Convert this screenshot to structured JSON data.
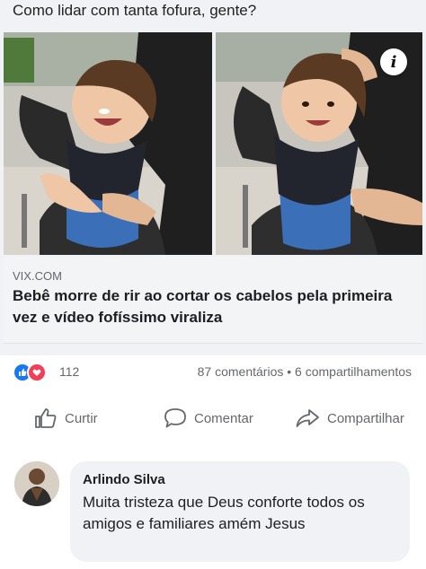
{
  "post": {
    "caption": "Como lidar com tanta fofura, gente?"
  },
  "link_preview": {
    "domain": "VIX.COM",
    "title": "Bebê morre de rir ao cortar os cabelos pela primeira vez e vídeo fofíssimo viraliza",
    "info_icon_glyph": "i"
  },
  "reactions": {
    "types": [
      "like-icon",
      "love-icon"
    ],
    "count": "112",
    "comments": "87 comentários",
    "separator": "•",
    "shares": "6 compartilhamentos"
  },
  "actions": {
    "like_label": "Curtir",
    "comment_label": "Comentar",
    "share_label": "Compartilhar"
  },
  "comment": {
    "author": "Arlindo Silva",
    "text": "Muita tristeza que Deus conforte todos os amigos e familiares amém Jesus"
  },
  "colors": {
    "like_blue": "#1877f2",
    "love_red": "#f33e58",
    "muted_text": "#65676b",
    "background": "#f0f2f5"
  }
}
